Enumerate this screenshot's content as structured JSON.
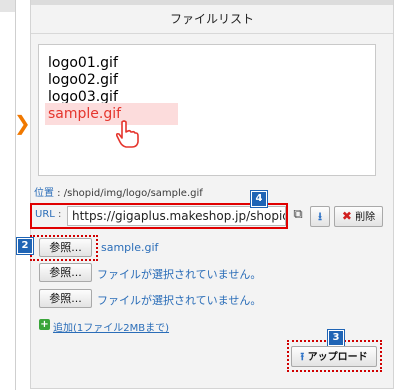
{
  "panel": {
    "title": "ファイルリスト"
  },
  "files": [
    {
      "name": "logo01.gif",
      "selected": false
    },
    {
      "name": "logo02.gif",
      "selected": false
    },
    {
      "name": "logo03.gif",
      "selected": false
    },
    {
      "name": "sample.gif",
      "selected": true
    }
  ],
  "path": {
    "label": "位置",
    "separator": " : ",
    "value": "/shopid/img/logo/sample.gif"
  },
  "url": {
    "label": "URL",
    "separator": " : ",
    "value": "https://gigaplus.makeshop.jp/shopid/img/logo/sample.gif"
  },
  "buttons": {
    "delete_label": "削除",
    "browse_label": "参照...",
    "upload_label": "アップロード"
  },
  "uploads": [
    {
      "status": "sample.gif"
    },
    {
      "status": "ファイルが選択されていません。"
    },
    {
      "status": "ファイルが選択されていません。"
    }
  ],
  "add_more_label": "追加(1ファイル2MBまで)",
  "badges": {
    "upload": "3",
    "browse": "2",
    "url": "4"
  },
  "colors": {
    "accent": "#f07800",
    "highlight_text": "#e5352d",
    "highlight_bg": "#fcdcdc",
    "link": "#2a6db8",
    "badge": "#1f64b5",
    "dotted": "#d00000"
  },
  "icons": [
    "chevron-right-icon",
    "hand-pointer-icon",
    "external-link-icon",
    "download-icon",
    "delete-x-icon",
    "plus-icon",
    "upload-icon"
  ]
}
